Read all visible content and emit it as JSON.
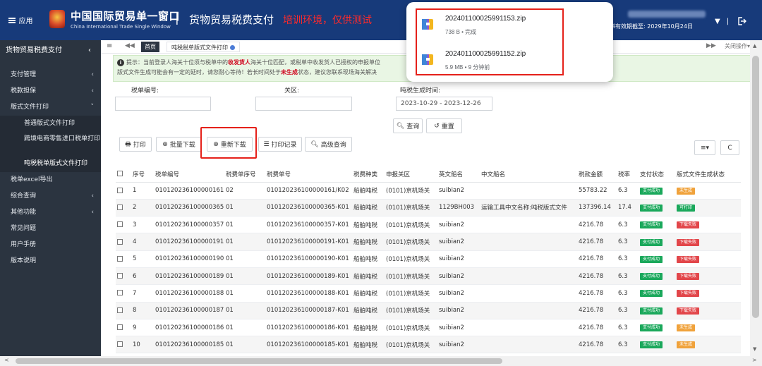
{
  "header": {
    "app_button": "应用",
    "brand_cn": "中国国际贸易单一窗口",
    "brand_en": "China International Trade Single Window",
    "separator": "|",
    "system_name": "货物贸易税费支付",
    "environment": "培训环境，仅供测试",
    "validity": "证书有效期截至: 2029年10月24日",
    "user_dropdown": "▼",
    "sep2": "|"
  },
  "sidebar": {
    "title": "货物贸易税费支付",
    "items": [
      {
        "label": "支付管理",
        "chevron": "‹"
      },
      {
        "label": "税款担保",
        "chevron": "‹"
      },
      {
        "label": "版式文件打印",
        "chevron": "˅"
      }
    ],
    "sub_items": [
      {
        "label": "普通版式文件打印"
      },
      {
        "label": "跨境电商零售进口税单打印"
      },
      {
        "label": "吨税税单版式文件打印"
      }
    ],
    "more_items": [
      {
        "label": "税单excel导出",
        "chevron": ""
      },
      {
        "label": "综合查询",
        "chevron": "‹"
      },
      {
        "label": "其他功能",
        "chevron": "‹"
      },
      {
        "label": "常见问题",
        "chevron": ""
      },
      {
        "label": "用户手册",
        "chevron": ""
      },
      {
        "label": "版本说明",
        "chevron": ""
      }
    ]
  },
  "tabs": {
    "menu": "≡",
    "prev": "◀◀",
    "home": "首页",
    "current": "吨税税单版式文件打印",
    "next": "▶▶",
    "close_ops": "关闭操作▾"
  },
  "notice": {
    "icon": "i",
    "p1": "提示：当前登录人海关十位须与税单中的",
    "red1": "收发货人",
    "p2": "海关十位匹配，或税单中收发货人已授权的申报单位",
    "line2a": "版式文件生成可能会有一定的延时，请您耐心等待！若长时间处于",
    "red2": "未生成",
    "line2b": "状态，建议您联系现场海关解决"
  },
  "search": {
    "tax_no_label": "税单编号:",
    "customs_label": "关区:",
    "time_label": "吨税生成时间:",
    "tax_no_value": "",
    "customs_value": "",
    "time_value": "2023-10-29 - 2023-12-26",
    "query_btn": "查询",
    "reset_btn": "重置"
  },
  "toolbar": {
    "print": "打印",
    "batch_download": "批量下载",
    "redownload": "重新下载",
    "print_record": "打印记录",
    "advanced_query": "高级查询",
    "column_toggle": "≡▾",
    "refresh": "C"
  },
  "table": {
    "headers": [
      "",
      "序号",
      "税单编号",
      "税费单序号",
      "税费单号",
      "税费种类",
      "申报关区",
      "英文船名",
      "中文船名",
      "税款金额",
      "税率",
      "支付状态",
      "版式文件生成状态"
    ],
    "rows": [
      {
        "seq": "1",
        "tax_no": "010120236100000161",
        "sub_seq": "02",
        "bill_no": "010120236100000161/K02",
        "kind": "船舶吨税",
        "customs": "(0101)京机场关",
        "en_name": "suibian2",
        "cn_name": "",
        "amount": "55783.22",
        "rate": "6.3",
        "pay": "支付成功",
        "gen": "未生成"
      },
      {
        "seq": "2",
        "tax_no": "010120236100000365",
        "sub_seq": "01",
        "bill_no": "010120236100000365-K01",
        "kind": "船舶吨税",
        "customs": "(0101)京机场关",
        "en_name": "1129BH003",
        "cn_name": "运输工具中文名称:吨税版式文件",
        "amount": "137396.14",
        "rate": "17.4",
        "pay": "支付成功",
        "gen": "可打印"
      },
      {
        "seq": "3",
        "tax_no": "010120236100000357",
        "sub_seq": "01",
        "bill_no": "010120236100000357-K01",
        "kind": "船舶吨税",
        "customs": "(0101)京机场关",
        "en_name": "suibian2",
        "cn_name": "",
        "amount": "4216.78",
        "rate": "6.3",
        "pay": "支付成功",
        "gen": "下载失败"
      },
      {
        "seq": "4",
        "tax_no": "010120236100000191",
        "sub_seq": "01",
        "bill_no": "010120236100000191-K01",
        "kind": "船舶吨税",
        "customs": "(0101)京机场关",
        "en_name": "suibian2",
        "cn_name": "",
        "amount": "4216.78",
        "rate": "6.3",
        "pay": "支付成功",
        "gen": "下载失败"
      },
      {
        "seq": "5",
        "tax_no": "010120236100000190",
        "sub_seq": "01",
        "bill_no": "010120236100000190-K01",
        "kind": "船舶吨税",
        "customs": "(0101)京机场关",
        "en_name": "suibian2",
        "cn_name": "",
        "amount": "4216.78",
        "rate": "6.3",
        "pay": "支付成功",
        "gen": "下载失败"
      },
      {
        "seq": "6",
        "tax_no": "010120236100000189",
        "sub_seq": "01",
        "bill_no": "010120236100000189-K01",
        "kind": "船舶吨税",
        "customs": "(0101)京机场关",
        "en_name": "suibian2",
        "cn_name": "",
        "amount": "4216.78",
        "rate": "6.3",
        "pay": "支付成功",
        "gen": "下载失败"
      },
      {
        "seq": "7",
        "tax_no": "010120236100000188",
        "sub_seq": "01",
        "bill_no": "010120236100000188-K01",
        "kind": "船舶吨税",
        "customs": "(0101)京机场关",
        "en_name": "suibian2",
        "cn_name": "",
        "amount": "4216.78",
        "rate": "6.3",
        "pay": "支付成功",
        "gen": "下载失败"
      },
      {
        "seq": "8",
        "tax_no": "010120236100000187",
        "sub_seq": "01",
        "bill_no": "010120236100000187-K01",
        "kind": "船舶吨税",
        "customs": "(0101)京机场关",
        "en_name": "suibian2",
        "cn_name": "",
        "amount": "4216.78",
        "rate": "6.3",
        "pay": "支付成功",
        "gen": "下载失败"
      },
      {
        "seq": "9",
        "tax_no": "010120236100000186",
        "sub_seq": "01",
        "bill_no": "010120236100000186-K01",
        "kind": "船舶吨税",
        "customs": "(0101)京机场关",
        "en_name": "suibian2",
        "cn_name": "",
        "amount": "4216.78",
        "rate": "6.3",
        "pay": "支付成功",
        "gen": "未生成"
      },
      {
        "seq": "10",
        "tax_no": "010120236100000185",
        "sub_seq": "01",
        "bill_no": "010120236100000185-K01",
        "kind": "船舶吨税",
        "customs": "(0101)京机场关",
        "en_name": "suibian2",
        "cn_name": "",
        "amount": "4216.78",
        "rate": "6.3",
        "pay": "支付成功",
        "gen": "未生成"
      }
    ],
    "status_colors": {
      "支付成功": "#1aa85b",
      "未生成": "#f0a23b",
      "可打印": "#1aa85b",
      "下载失败": "#e2464a"
    }
  },
  "downloads": {
    "items": [
      {
        "name": "202401100025991153.zip",
        "meta": "738 B • 完成"
      },
      {
        "name": "202401100025991152.zip",
        "meta": "5.9 MB • 9 分钟前"
      }
    ]
  },
  "scroll": {
    "up": "▲",
    "down": "▼",
    "left": "<",
    "right": ">"
  }
}
